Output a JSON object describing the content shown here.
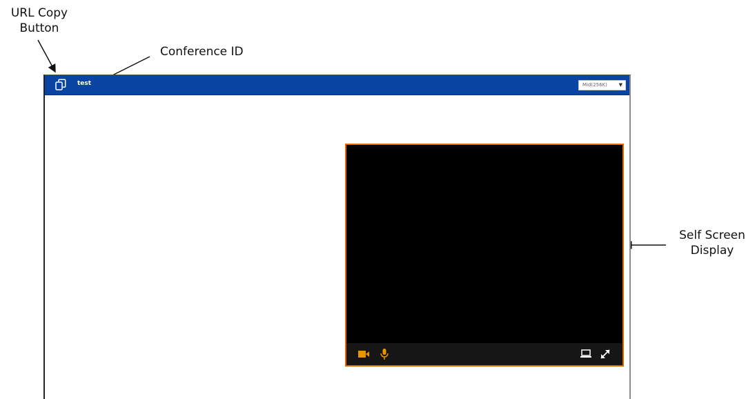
{
  "annotations": {
    "url_copy": "URL Copy\nButton",
    "conference_id": "Conference ID",
    "self_screen": "Self Screen\nDisplay"
  },
  "topbar": {
    "conference_id": "test",
    "quality": {
      "selected": "Mid(256K)"
    }
  },
  "self_view": {
    "controls": [
      "camera-icon",
      "microphone-icon",
      "screen-share-icon",
      "fullscreen-icon"
    ]
  },
  "colors": {
    "topbar": "#0a44a3",
    "accent": "#e69500",
    "frame": "#e06a00"
  }
}
